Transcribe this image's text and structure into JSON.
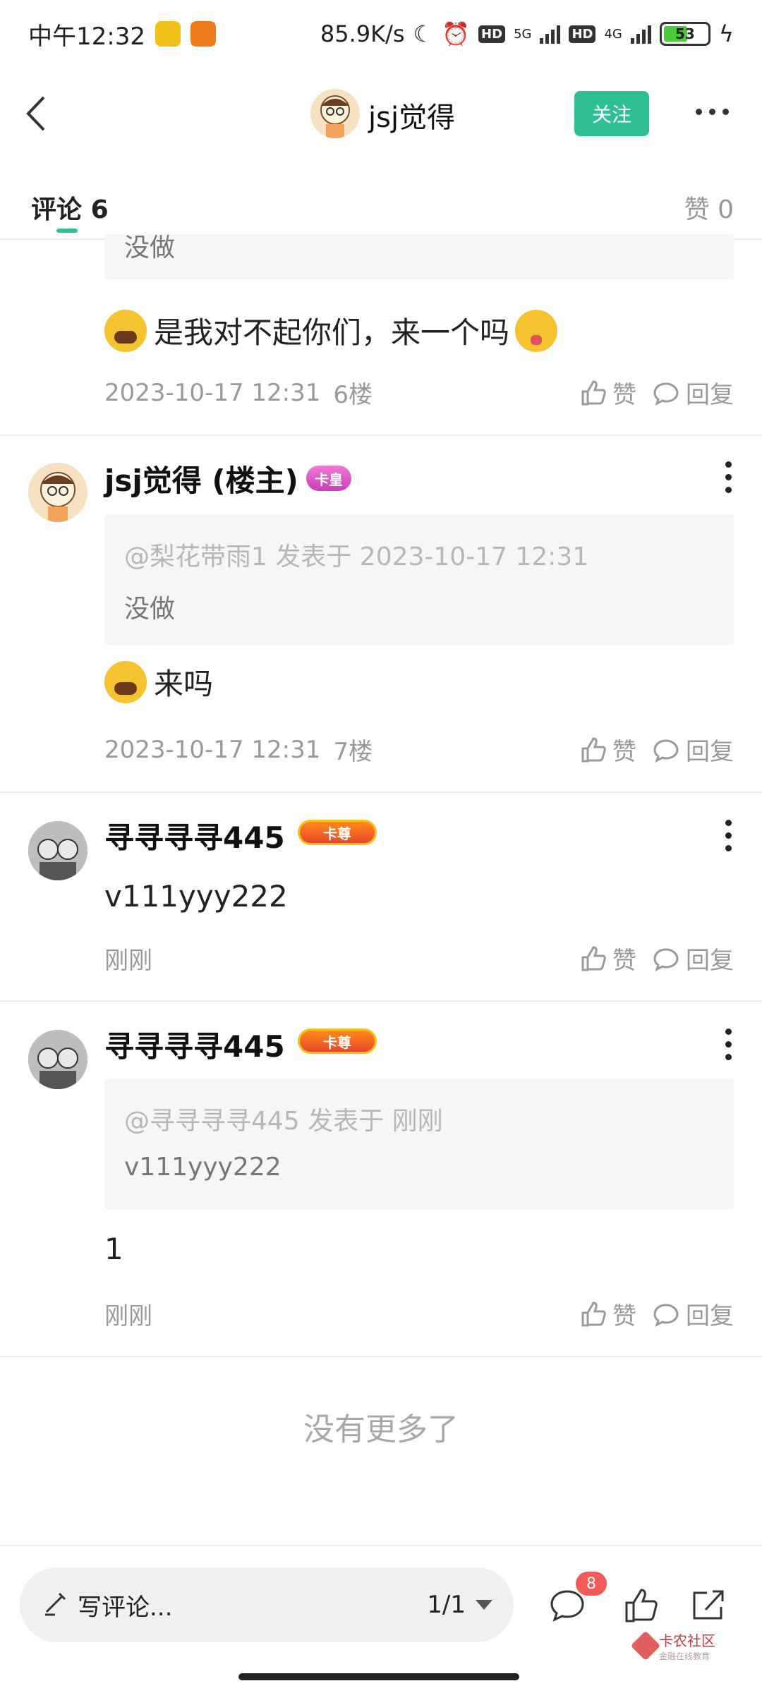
{
  "status_bar": {
    "time": "中午12:32",
    "net_speed": "85.9K/s",
    "net_5g": "5G",
    "net_4g": "4G",
    "hd": "HD",
    "battery": "53"
  },
  "header": {
    "title": "jsj觉得",
    "follow_label": "关注"
  },
  "tabs": {
    "comments_label": "评论",
    "comments_count": "6",
    "likes_label": "赞",
    "likes_count": "0"
  },
  "comments": [
    {
      "quote_text": "没做",
      "body": "是我对不起你们，来一个吗",
      "date": "2023-10-17 12:31",
      "floor": "6楼"
    },
    {
      "username": "jsj觉得 (楼主)",
      "badge": "卡皇",
      "quote_meta": "@梨花带雨1 发表于 2023-10-17 12:31",
      "quote_text": "没做",
      "body": "来吗",
      "date": "2023-10-17 12:31",
      "floor": "7楼"
    },
    {
      "username": "寻寻寻寻445",
      "badge": "卡尊",
      "body": "v111yyy222",
      "date": "刚刚"
    },
    {
      "username": "寻寻寻寻445",
      "badge": "卡尊",
      "quote_meta": "@寻寻寻寻445 发表于 刚刚",
      "quote_text": "v111yyy222",
      "body": "1",
      "date": "刚刚"
    }
  ],
  "actions": {
    "like_label": "赞",
    "reply_label": "回复"
  },
  "no_more_text": "没有更多了",
  "bottom_bar": {
    "write_placeholder": "写评论...",
    "pager": "1/1",
    "comment_count_badge": "8",
    "brand_name": "卡农社区",
    "brand_sub": "金融在线教育"
  },
  "colors": {
    "accent": "#2fbf95",
    "badge_red": "#f25a5a"
  }
}
